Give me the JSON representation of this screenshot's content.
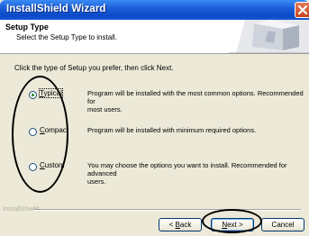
{
  "window": {
    "title": "InstallShield Wizard"
  },
  "header": {
    "title": "Setup Type",
    "subtitle": "Select the Setup Type to install."
  },
  "instruction": "Click the type of Setup you prefer, then click Next.",
  "options": [
    {
      "key": "T",
      "rest": "ypical",
      "selected": true,
      "desc1": "Program will be installed with the most common options.  Recommended for",
      "desc2": "most users."
    },
    {
      "key": "C",
      "rest": "ompact",
      "selected": false,
      "desc1": "Program will be installed with minimum required options.",
      "desc2": ""
    },
    {
      "key": "C",
      "rest": "ustom",
      "selected": false,
      "desc1": "You may choose the options you want to install. Recommended for advanced",
      "desc2": "users."
    }
  ],
  "brand": "InstallShield",
  "buttons": {
    "back": {
      "pre": "< ",
      "key": "B",
      "rest": "ack"
    },
    "next": {
      "key": "N",
      "rest": "ext >"
    },
    "cancel": "Cancel"
  },
  "colors": {
    "title_bar": "#0b49c6",
    "face": "#ece9d8",
    "annotation": "#000000"
  }
}
